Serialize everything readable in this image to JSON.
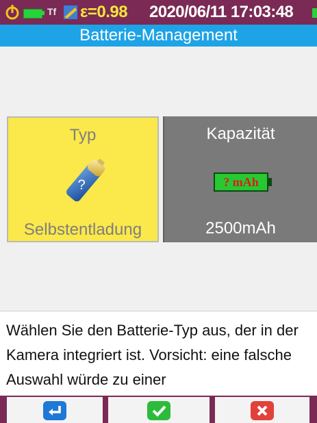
{
  "status_bar": {
    "emissivity": "ε=0.98",
    "datetime": "2020/06/11 17:03:48",
    "tf_label": "Tf",
    "icons": [
      "power-icon",
      "battery-icon",
      "emissivity-icon"
    ],
    "colors": {
      "bar": "#7a2a55",
      "emissivity": "#f6e63a",
      "battery": "#27d23b"
    }
  },
  "header": {
    "title": "Batterie-Management",
    "color": "#1ea3e6"
  },
  "tiles": {
    "type": {
      "title": "Typ",
      "value": "Selbstentladung",
      "icon": "battery-question-icon",
      "color": "#fbe84a"
    },
    "capacity": {
      "title": "Kapazität",
      "indicator": "? mAh",
      "value": "2500mAh",
      "color": "#7a7a7a"
    }
  },
  "help_text": "Wählen Sie den Batterie-Typ aus, der in der Kamera integriert ist. Vorsicht: eine falsche Auswahl würde zu einer",
  "softkeys": [
    {
      "icon": "enter-icon",
      "color": "#1f78d6"
    },
    {
      "icon": "check-icon",
      "color": "#2dbb3c"
    },
    {
      "icon": "cancel-icon",
      "color": "#e2403a"
    }
  ]
}
